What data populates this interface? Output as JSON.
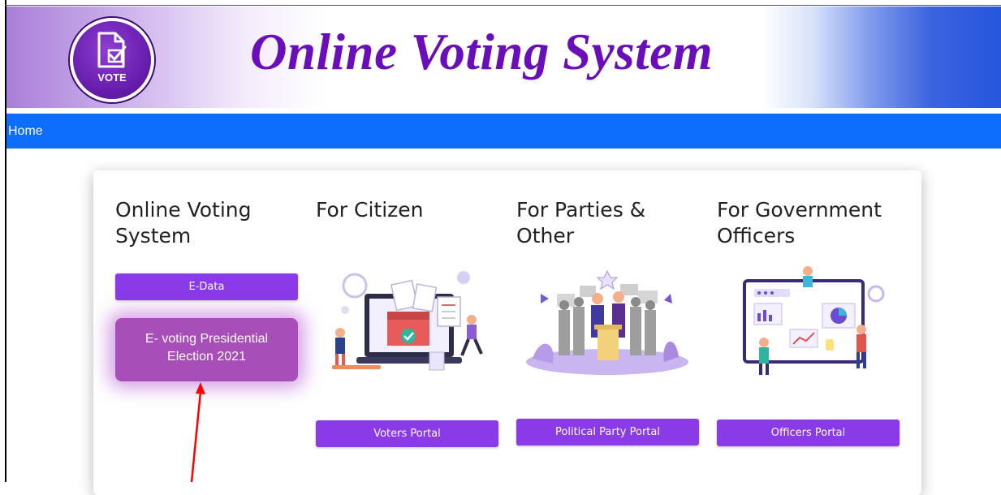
{
  "header": {
    "logo_text": "VOTE",
    "title": "Online Voting System"
  },
  "nav": {
    "home": "Home"
  },
  "columns": {
    "system": {
      "title_line1": "Online Voting",
      "title_line2": "System",
      "edata_label": "E-Data",
      "evoting_line1": "E- voting Presidential",
      "evoting_line2": "Election 2021"
    },
    "citizen": {
      "title_line1": "For Citizen",
      "button": "Voters Portal"
    },
    "parties": {
      "title_line1": "For Parties &",
      "title_line2": "Other",
      "button": "Political Party Portal"
    },
    "government": {
      "title_line1": "For Government",
      "title_line2": "Officers",
      "button": "Officers Portal"
    }
  },
  "colors": {
    "accent_purple": "#8a3ae6",
    "evoting_button": "#a74eb8",
    "navbar_blue": "#0d6efd",
    "title_purple": "#6a0dbb",
    "annotation_arrow": "#ff0000"
  }
}
